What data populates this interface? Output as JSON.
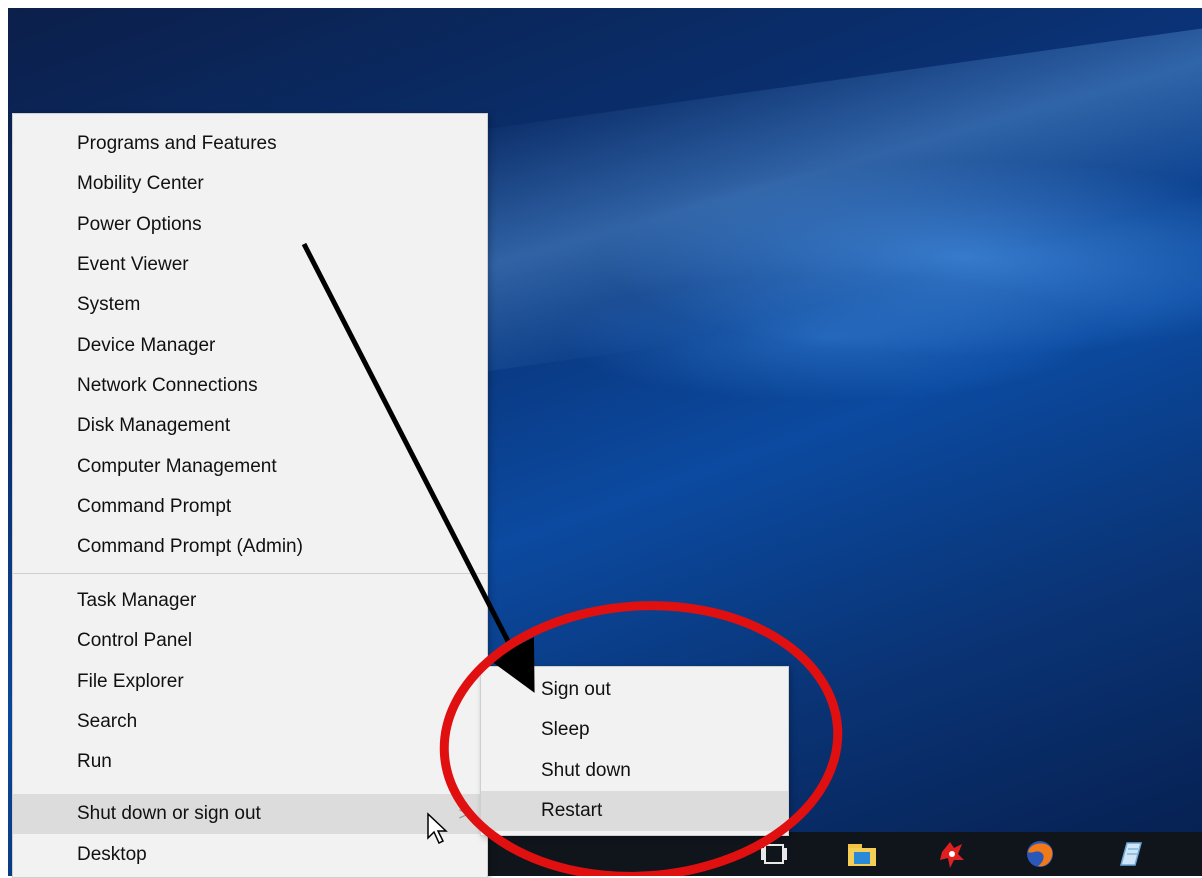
{
  "context_menu": {
    "groups": [
      [
        "Programs and Features",
        "Mobility Center",
        "Power Options",
        "Event Viewer",
        "System",
        "Device Manager",
        "Network Connections",
        "Disk Management",
        "Computer Management",
        "Command Prompt",
        "Command Prompt (Admin)"
      ],
      [
        "Task Manager",
        "Control Panel",
        "File Explorer",
        "Search",
        "Run",
        "Shut down or sign out",
        "Desktop"
      ]
    ],
    "highlighted_item": "Shut down or sign out",
    "submenu_arrow": ">"
  },
  "submenu": {
    "items": [
      "Sign out",
      "Sleep",
      "Shut down",
      "Restart"
    ],
    "highlighted_item": "Restart"
  },
  "taskbar": {
    "icons": [
      "task-view-icon",
      "file-explorer-icon",
      "red-app-icon",
      "firefox-icon",
      "notepad-icon"
    ]
  },
  "annotations": {
    "arrow_color": "#000000",
    "circle_color": "#e01010"
  },
  "colors": {
    "menu_bg": "#f2f2f2",
    "highlight_bg": "#dcdcdc",
    "desktop_blue": "#0b4aa0"
  }
}
